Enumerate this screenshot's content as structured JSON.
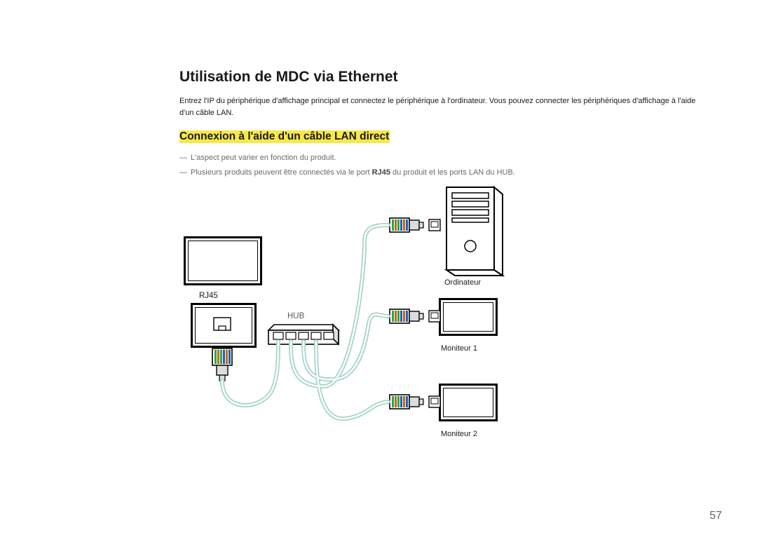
{
  "title": "Utilisation de MDC via Ethernet",
  "intro": "Entrez l'IP du périphérique d'affichage principal et connectez le périphérique à l'ordinateur. Vous pouvez connecter les périphériques d'affichage à l'aide d'un câble LAN.",
  "subheading": "Connexion à l'aide d'un câble LAN direct",
  "notes": [
    "L'aspect peut varier en fonction du produit.",
    "Plusieurs produits peuvent être connectés via le port RJ45 du produit et les ports LAN du HUB."
  ],
  "note_bold_segments": {
    "1": "RJ45"
  },
  "diagram": {
    "rj45_label": "RJ45",
    "hub_label": "HUB",
    "computer_label": "Ordinateur",
    "monitor1_label": "Moniteur 1",
    "monitor2_label": "Moniteur 2"
  },
  "page_number": "57"
}
